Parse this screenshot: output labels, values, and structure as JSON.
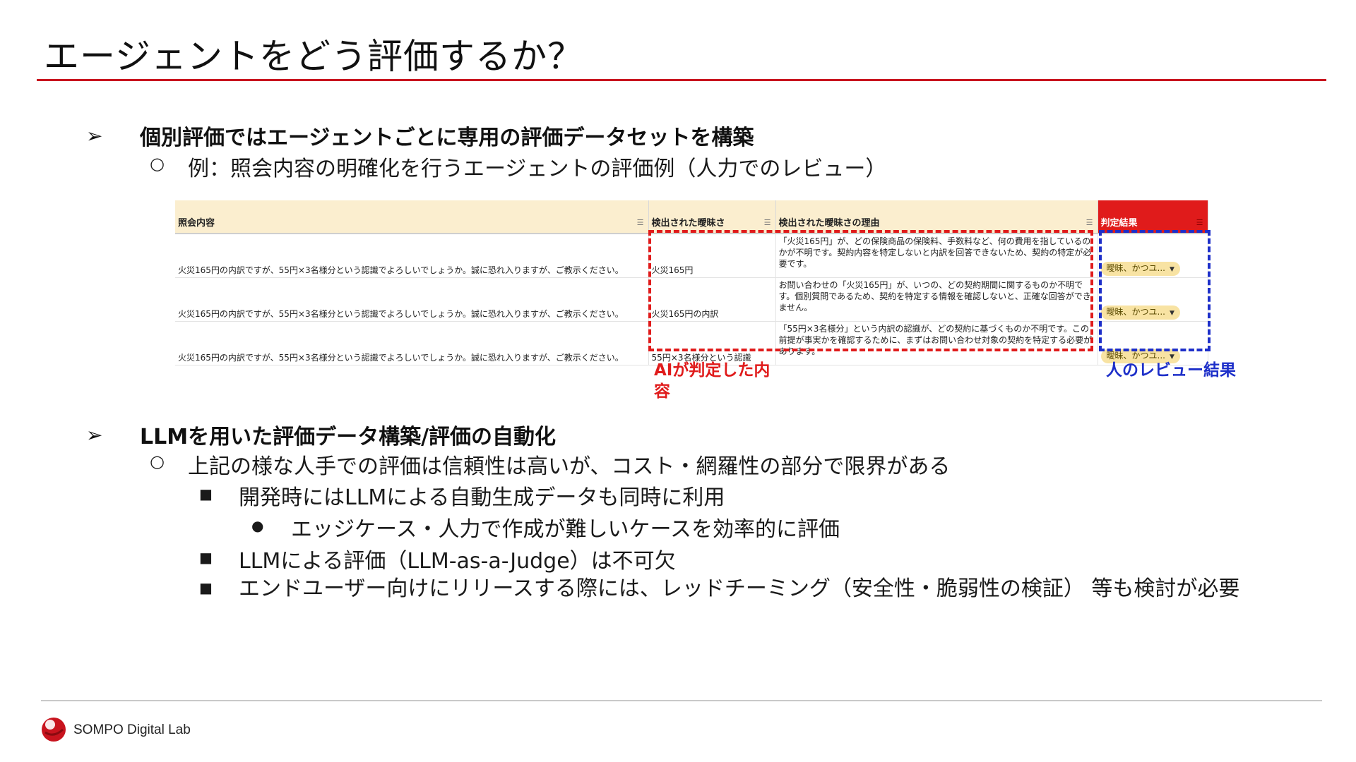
{
  "slide": {
    "title": "エージェントをどう評価するか？"
  },
  "section1": {
    "marker": "➢",
    "heading": "個別評価ではエージェントごとに専用の評価データセットを構築",
    "sub_marker": "○",
    "sub_text": "例：照会内容の明確化を行うエージェントの評価例（人力でのレビュー）"
  },
  "sheet": {
    "headers": [
      "照会内容",
      "検出された曖昧さ",
      "検出された曖昧さの理由",
      "判定結果"
    ],
    "rows": [
      {
        "query": "火災165円の内訳ですが、55円×3名様分という認識でよろしいでしょうか。誠に恐れ入りますが、ご教示ください。",
        "ambiguity": "火災165円",
        "reason": "「火災165円」が、どの保険商品の保険料、手数料など、何の費用を指しているのかが不明です。契約内容を特定しないと内訳を回答できないため、契約の特定が必要です。",
        "result": "曖昧、かつユ..."
      },
      {
        "query": "火災165円の内訳ですが、55円×3名様分という認識でよろしいでしょうか。誠に恐れ入りますが、ご教示ください。",
        "ambiguity": "火災165円の内訳",
        "reason": "お問い合わせの「火災165円」が、いつの、どの契約期間に関するものか不明です。個別質問であるため、契約を特定する情報を確認しないと、正確な回答ができません。",
        "result": "曖昧、かつユ..."
      },
      {
        "query": "火災165円の内訳ですが、55円×3名様分という認識でよろしいでしょうか。誠に恐れ入りますが、ご教示ください。",
        "ambiguity": "55円×3名様分という認識",
        "reason": "「55円×3名様分」という内訳の認識が、どの契約に基づくものか不明です。この前提が事実かを確認するために、まずはお問い合わせ対象の契約を特定する必要があります。",
        "result": "曖昧、かつユ..."
      }
    ],
    "annotation_ai": "AIが判定した内容",
    "annotation_human": "人のレビュー結果",
    "colors": {
      "ai_box": "#e01b1b",
      "human_box": "#1d2fc9",
      "result_header": "#e01b1b"
    }
  },
  "section2": {
    "marker": "➢",
    "heading": "LLMを用いた評価データ構築/評価の自動化",
    "items": [
      {
        "marker": "○",
        "text": "上記の様な人手での評価は信頼性は高いが、コスト・網羅性の部分で限界がある"
      },
      {
        "marker": "■",
        "text": "開発時にはLLMによる自動生成データも同時に利用"
      },
      {
        "marker": "●",
        "text": "エッジケース・人力で作成が難しいケースを効率的に評価"
      },
      {
        "marker": "■",
        "text": "LLMによる評価（LLM-as-a-Judge）は不可欠"
      },
      {
        "marker": "■",
        "text": "エンドユーザー向けにリリースする際には、レッドチーミング（安全性・脆弱性の検証） 等も検討が必要"
      }
    ]
  },
  "footer": {
    "brand": "SOMPO Digital Lab",
    "logo_icon": "sompo-logo-icon",
    "accent_color": "#c8141e"
  }
}
